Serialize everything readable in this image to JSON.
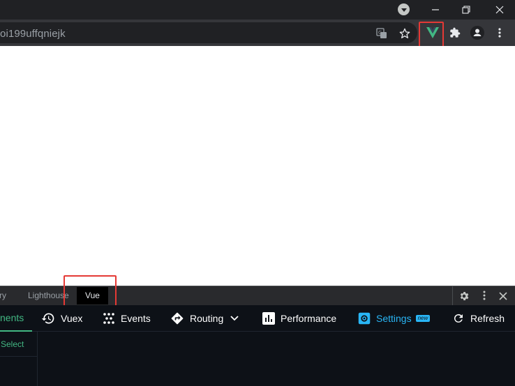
{
  "browser": {
    "address_bar": {
      "url_text": "oi199uffqniejk"
    },
    "toolbar_icons": [
      "translate-icon",
      "star-icon",
      "vue-extension-icon",
      "puzzle-icon",
      "profile-icon",
      "more-vert-icon"
    ],
    "window_controls": [
      "tab-search-icon",
      "minimize-icon",
      "restore-icon",
      "close-icon"
    ]
  },
  "devtools": {
    "tabs": [
      {
        "label": "ry"
      },
      {
        "label": "Lighthouse"
      },
      {
        "label": "Vue"
      }
    ],
    "active_tab": "Vue",
    "right_icons": [
      "gear-icon",
      "more-vert-icon",
      "close-icon"
    ]
  },
  "vue_devtools": {
    "nav": {
      "components": "nents",
      "vuex": "Vuex",
      "events": "Events",
      "routing": "Routing",
      "performance": "Performance",
      "settings": "Settings",
      "settings_badge": "new",
      "refresh": "Refresh"
    },
    "select_label": "Select"
  },
  "colors": {
    "vue_green": "#42b883",
    "highlight_red": "#e53935",
    "settings_blue": "#29b6f6",
    "devtools_bg": "#0d1117",
    "chrome_dark": "#202124"
  }
}
